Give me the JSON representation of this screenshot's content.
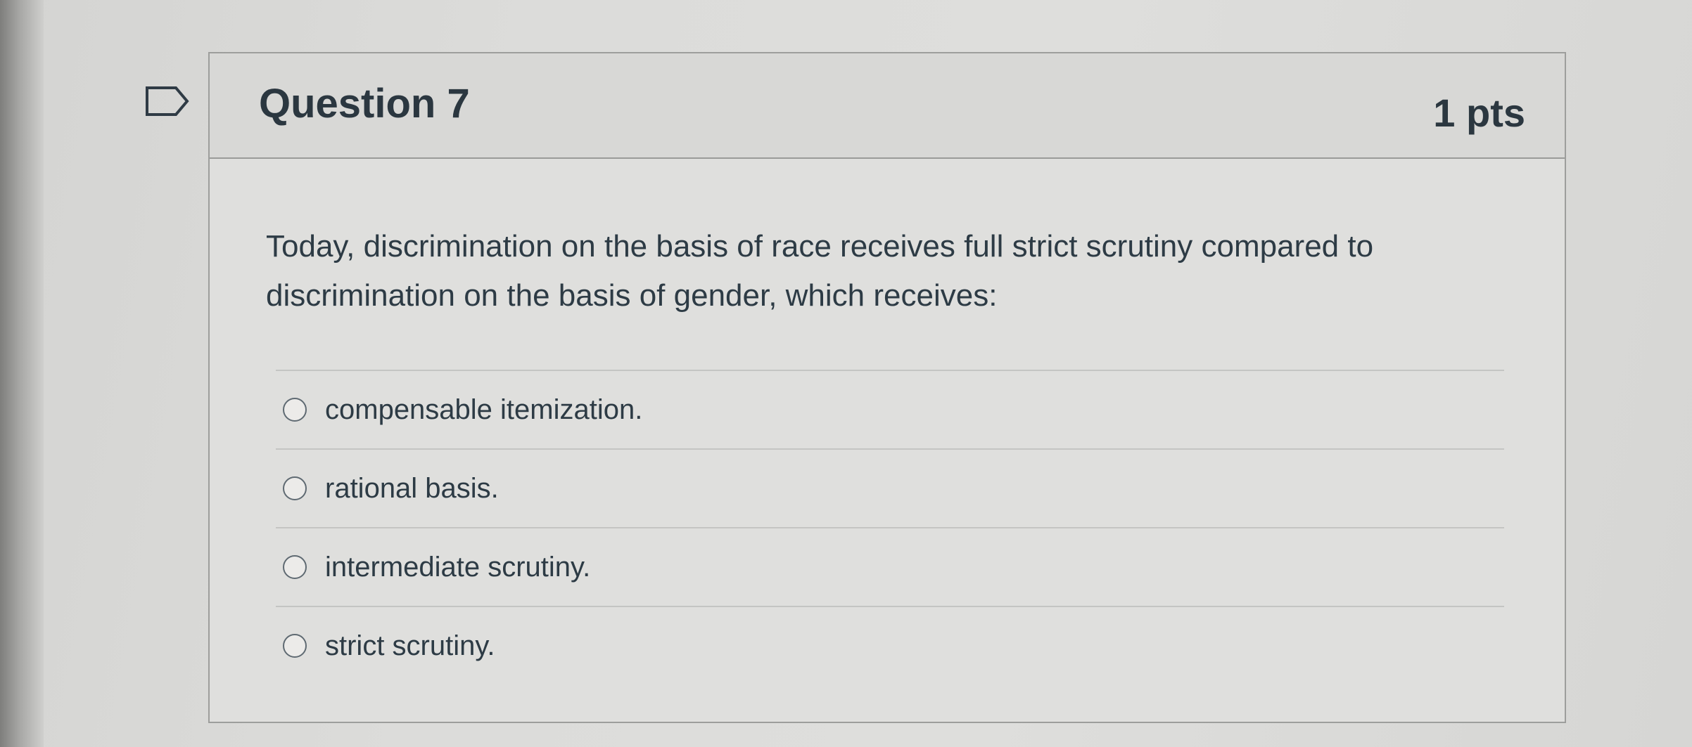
{
  "question": {
    "title": "Question 7",
    "points": "1 pts",
    "text": "Today, discrimination on the basis of race receives full strict scrutiny compared to discrimination on the basis of gender, which receives:"
  },
  "answers": [
    {
      "label": "compensable itemization.",
      "selected": false
    },
    {
      "label": "rational basis.",
      "selected": false
    },
    {
      "label": "intermediate scrutiny.",
      "selected": false
    },
    {
      "label": "strict scrutiny.",
      "selected": false
    }
  ],
  "icons": {
    "flag": "flag-question-icon",
    "radio": "radio-button-icon"
  },
  "colors": {
    "text": "#2d3b45",
    "border": "#9d9e9c",
    "header_background": "#d8d8d6"
  }
}
